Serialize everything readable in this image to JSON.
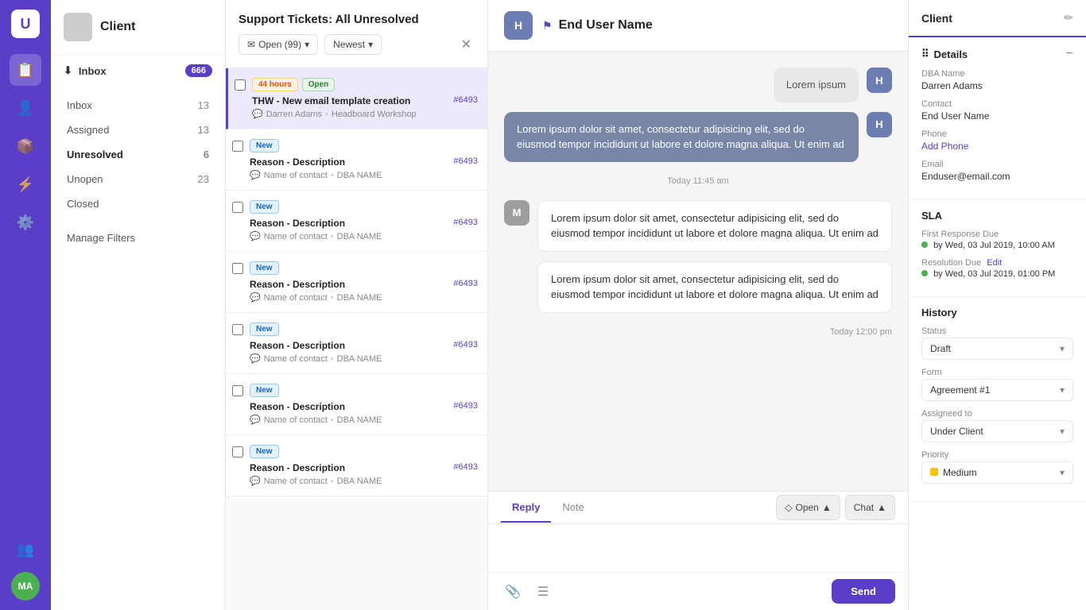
{
  "app": {
    "logo": "U",
    "nav_avatar": "MA"
  },
  "sidebar": {
    "client_name": "Client",
    "inbox_label": "Inbox",
    "inbox_count": "666",
    "nav_items": [
      {
        "label": "Inbox",
        "count": "13",
        "active": false
      },
      {
        "label": "Assigned",
        "count": "13",
        "active": false
      },
      {
        "label": "Unresolved",
        "count": "6",
        "active": true
      },
      {
        "label": "Unopen",
        "count": "23",
        "active": false
      },
      {
        "label": "Closed",
        "count": "",
        "active": false
      }
    ],
    "manage_filters": "Manage Filters"
  },
  "ticket_list": {
    "title": "Support Tickets: All Unresolved",
    "filter_open": "Open (99)",
    "filter_newest": "Newest",
    "tickets": [
      {
        "badges": [
          "44 hours",
          "Open"
        ],
        "subject": "THW - New email template creation",
        "id": "#6493",
        "contact": "Darren Adams",
        "dba": "Headboard Workshop",
        "selected": true
      },
      {
        "badges": [
          "New"
        ],
        "subject": "Reason - Description",
        "id": "#6493",
        "contact": "Name of contact",
        "dba": "DBA NAME",
        "selected": false
      },
      {
        "badges": [
          "New"
        ],
        "subject": "Reason - Description",
        "id": "#6493",
        "contact": "Name of contact",
        "dba": "DBA NAME",
        "selected": false
      },
      {
        "badges": [
          "New"
        ],
        "subject": "Reason - Description",
        "id": "#6493",
        "contact": "Name of contact",
        "dba": "DBA NAME",
        "selected": false
      },
      {
        "badges": [
          "New"
        ],
        "subject": "Reason - Description",
        "id": "#6493",
        "contact": "Name of contact",
        "dba": "DBA NAME",
        "selected": false
      },
      {
        "badges": [
          "New"
        ],
        "subject": "Reason - Description",
        "id": "#6493",
        "contact": "Name of contact",
        "dba": "DBA NAME",
        "selected": false
      },
      {
        "badges": [
          "New"
        ],
        "subject": "Reason - Description",
        "id": "#6493",
        "contact": "Name of contact",
        "dba": "DBA NAME",
        "selected": false
      }
    ]
  },
  "conversation": {
    "avatar_initials": "H",
    "contact_name": "End User Name",
    "messages": [
      {
        "type": "received-short",
        "avatar": "H",
        "avatar_class": "h",
        "text": "Lorem ipsum",
        "time": null
      },
      {
        "type": "received",
        "avatar": "H",
        "avatar_class": "h",
        "text": "Lorem ipsum dolor sit amet, consectetur adipisicing elit, sed do eiusmod tempor incididunt ut labore et dolore magna aliqua. Ut enim ad",
        "time": "Today 11:45 am"
      },
      {
        "type": "sent",
        "avatar": "M",
        "avatar_class": "m",
        "text": "Lorem ipsum dolor sit amet, consectetur adipisicing elit, sed do eiusmod tempor incididunt ut labore et dolore magna aliqua. Ut enim ad",
        "time": null
      },
      {
        "type": "sent",
        "avatar": null,
        "avatar_class": null,
        "text": "Lorem ipsum dolor sit amet, consectetur adipisicing elit, sed do eiusmod tempor incididunt ut labore et dolore magna aliqua. Ut enim ad",
        "time": "Today 12:00 pm"
      }
    ],
    "reply": {
      "tab_reply": "Reply",
      "tab_note": "Note",
      "action_open": "Open",
      "action_chat": "Chat",
      "send_label": "Send"
    }
  },
  "right_panel": {
    "title": "Client",
    "details_section": "Details",
    "dba_label": "DBA Name",
    "dba_value": "Darren Adams",
    "contact_label": "Contact",
    "contact_value": "End User Name",
    "phone_label": "Phone",
    "phone_value": "Add Phone",
    "email_label": "Email",
    "email_value": "Enduser@email.com",
    "sla_section": "SLA",
    "first_response_label": "First Response Due",
    "first_response_value": "by Wed, 03 Jul 2019, 10:00 AM",
    "resolution_label": "Resolution Due",
    "resolution_edit": "Edit",
    "resolution_value": "by Wed, 03 Jul 2019, 01:00 PM",
    "history_section": "History",
    "status_label": "Status",
    "status_value": "Draft",
    "form_label": "Form",
    "form_value": "Agreement #1",
    "assigned_label": "Assigneed to",
    "assigned_value": "Under Client",
    "priority_label": "Priority",
    "priority_value": "Medium"
  }
}
